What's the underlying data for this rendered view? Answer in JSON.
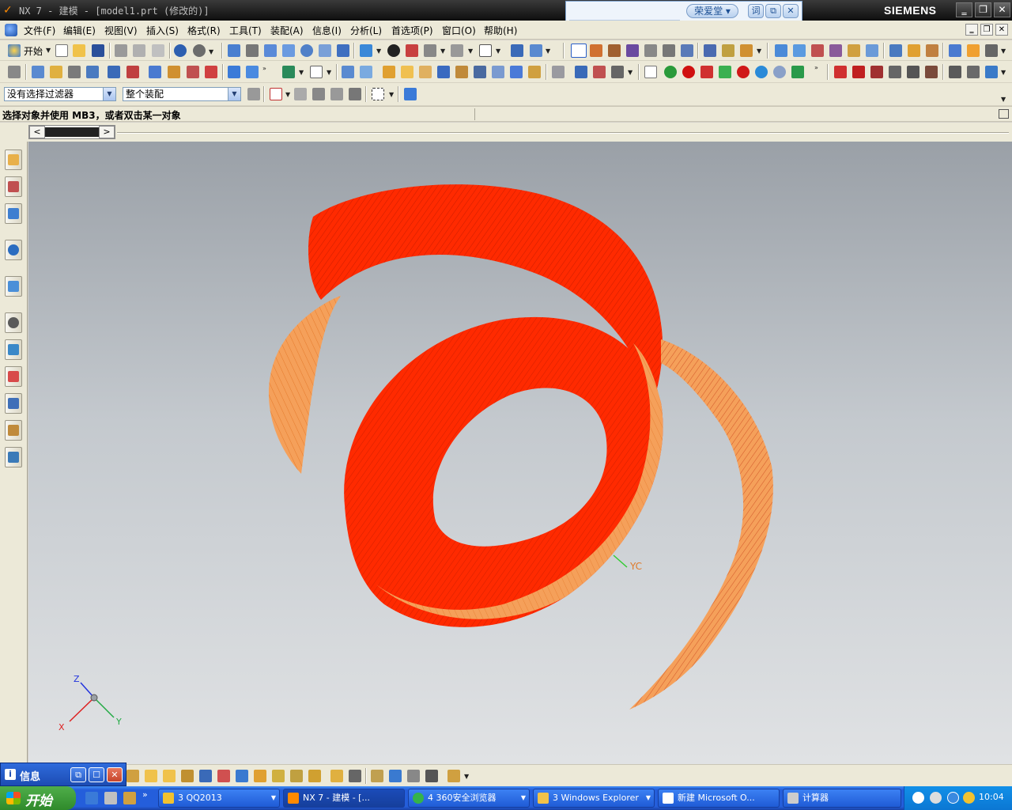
{
  "title_bar": {
    "app_icon": "nx-logo-icon",
    "title": "NX 7 - 建模 - [model1.prt (修改的)]",
    "brand": "SIEMENS",
    "buttons": {
      "minimize": "‗",
      "restore": "❐",
      "close": "✕"
    }
  },
  "dictionary_popup": {
    "input_value": "",
    "word_button": "荣爱堂 ▾",
    "btn_lookup": "词",
    "btn_copy": "⧉",
    "btn_close": "✕"
  },
  "menu_bar": {
    "items": [
      "文件(F)",
      "编辑(E)",
      "视图(V)",
      "插入(S)",
      "格式(R)",
      "工具(T)",
      "装配(A)",
      "信息(I)",
      "分析(L)",
      "首选项(P)",
      "窗口(O)",
      "帮助(H)"
    ],
    "mdi_buttons": [
      "‗",
      "❐",
      "✕"
    ]
  },
  "standard_toolbar": {
    "start_label": "开始"
  },
  "selection_bar": {
    "type_filter": "没有选择过滤器",
    "scope_filter": "整个装配"
  },
  "cue_line": {
    "message": "选择对象并使用 MB3，或者双击某一对象"
  },
  "scroll_strip": {
    "prev": "<",
    "next": ">"
  },
  "resource_bar": {
    "items": [
      {
        "name": "assembly-navigator",
        "color": "#e8b04a"
      },
      {
        "name": "constraint-navigator",
        "color": "#c05050"
      },
      {
        "name": "part-navigator",
        "color": "#3f7fd0"
      },
      {
        "name": "reuse-library",
        "color": "#2a6cc0"
      },
      {
        "name": "hd3d-tools",
        "color": "#4a8fd8"
      },
      {
        "name": "history",
        "color": "#5a5a5a"
      },
      {
        "name": "system-materials",
        "color": "#3a88c8"
      },
      {
        "name": "process-studio",
        "color": "#d84a4a"
      },
      {
        "name": "manufacturing-wizards",
        "color": "#3f6fb8"
      },
      {
        "name": "roles",
        "color": "#c08a3a"
      },
      {
        "name": "system-scenes",
        "color": "#3a7ab8"
      }
    ]
  },
  "viewport": {
    "wcs_label": "YC",
    "triad": {
      "x": "X",
      "y": "Y",
      "z": "Z"
    },
    "colors": {
      "surface_front": "#ff2a00",
      "surface_back": "#f5a05a",
      "mesh": "#c81a00"
    }
  },
  "info_window": {
    "label": "信息",
    "icon": "i",
    "buttons": [
      "⧉",
      "☐",
      "✕"
    ]
  },
  "taskbar": {
    "start_label": "开始",
    "tasks": [
      {
        "label": "3 QQ2013",
        "icon_color": "#f2c230"
      },
      {
        "label": "NX 7 - 建模 - [...",
        "icon_color": "#ff8a00"
      },
      {
        "label": "4 360安全浏览器",
        "icon_color": "#35b34a"
      },
      {
        "label": "3 Windows Explorer",
        "icon_color": "#f0c24a"
      },
      {
        "label": "新建 Microsoft O...",
        "icon_color": "#ffffff"
      },
      {
        "label": "计算器",
        "icon_color": "#cccccc"
      }
    ],
    "clock": "10:04"
  }
}
